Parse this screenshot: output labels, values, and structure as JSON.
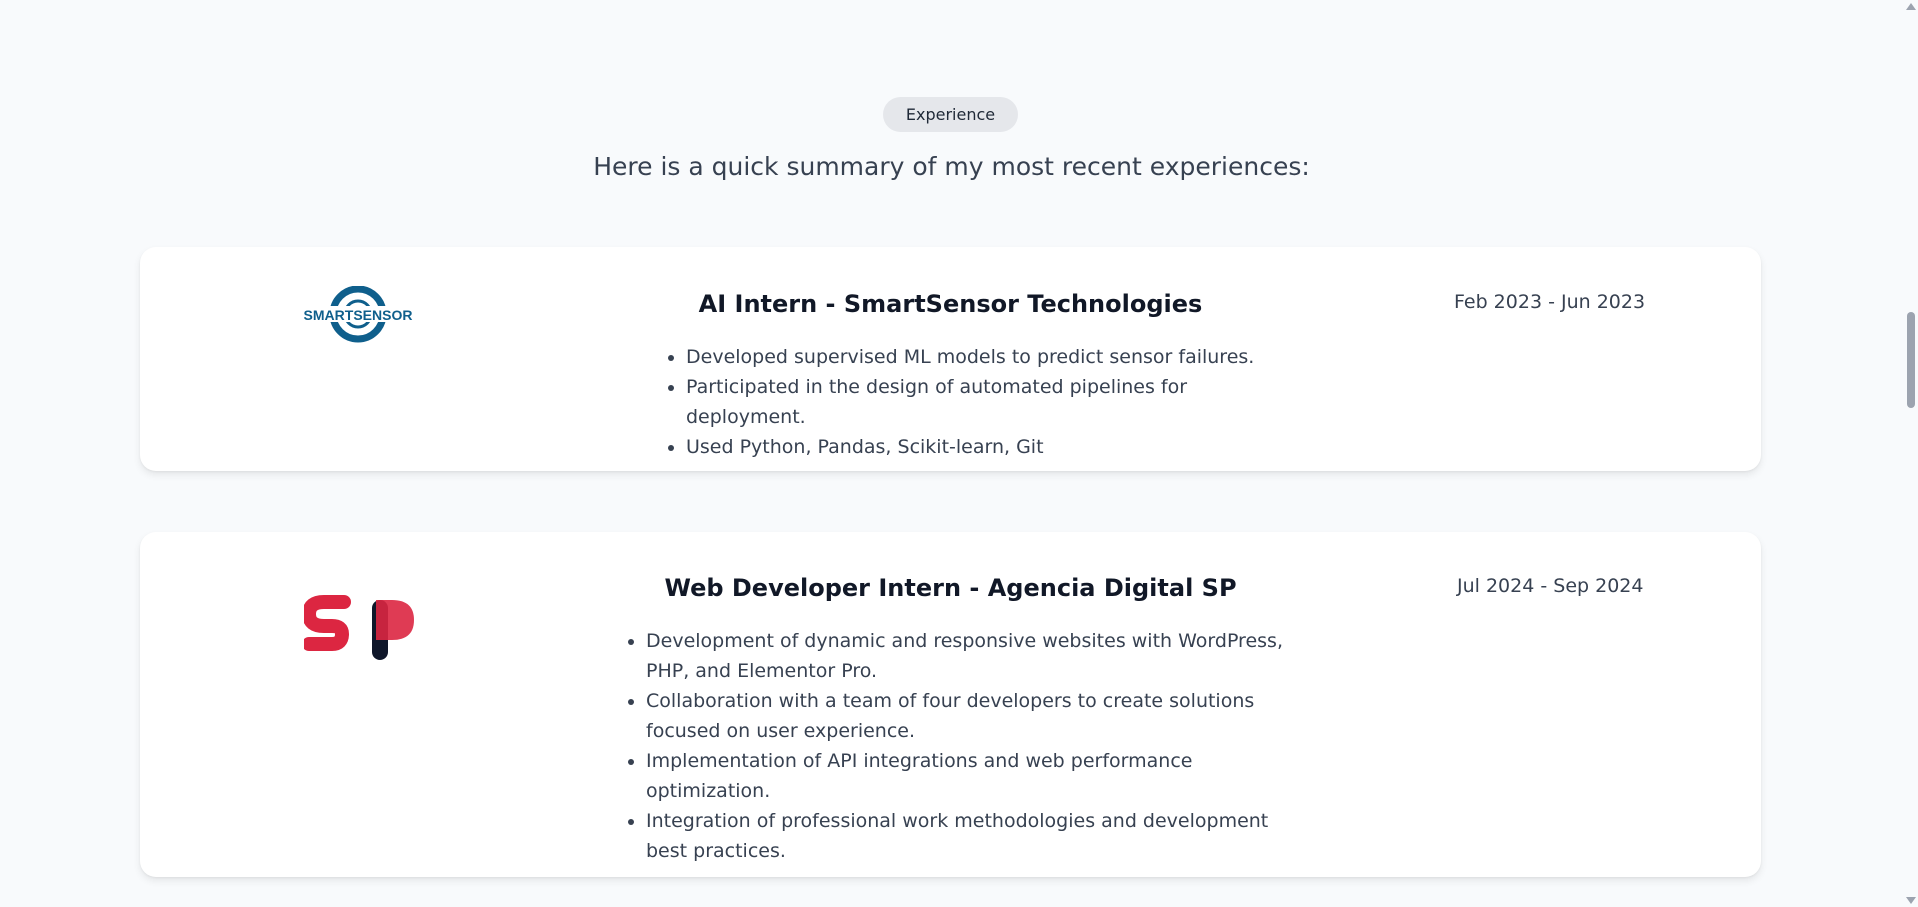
{
  "section": {
    "badge": "Experience",
    "intro": "Here is a quick summary of my most recent experiences:"
  },
  "experiences": [
    {
      "logo": "SMARTSENSOR",
      "title": "AI Intern - SmartSensor Technologies",
      "dates": "Feb 2023 - Jun 2023",
      "bullets": [
        "Developed supervised ML models to predict sensor failures.",
        "Participated in the design of automated pipelines for deployment.",
        "Used Python, Pandas, Scikit-learn, Git"
      ]
    },
    {
      "logo": "SP",
      "title": "Web Developer Intern - Agencia Digital SP",
      "dates": "Jul 2024 - Sep 2024",
      "bullets": [
        "Development of dynamic and responsive websites with WordPress, PHP, and Elementor Pro.",
        "Collaboration with a team of four developers to create solutions focused on user experience.",
        "Implementation of API integrations and web performance optimization.",
        "Integration of professional work methodologies and development best practices."
      ]
    }
  ],
  "colors": {
    "smartsensor_blue": "#0f5f8c",
    "sp_red": "#dc2641",
    "sp_navy": "#0f172a",
    "page_bg": "#f8fafc"
  }
}
